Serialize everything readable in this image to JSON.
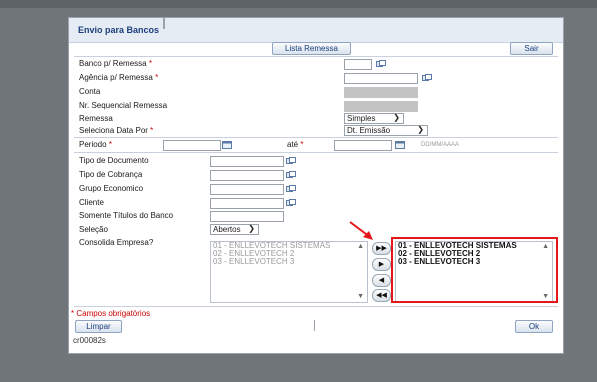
{
  "window": {
    "title": "Envio para Bancos"
  },
  "toolbar": {
    "lista_remessa": "Lista Remessa",
    "sair": "Sair"
  },
  "fields": {
    "banco_label": "Banco p/ Remessa",
    "agencia_label": "Agência p/ Remessa",
    "conta_label": "Conta",
    "nr_seq_label": "Nr. Sequencial Remessa",
    "remessa_label": "Remessa",
    "remessa_value": "Simples",
    "data_por_label": "Seleciona Data Por",
    "data_por_value": "Dt. Emissão",
    "periodo_label": "Periodo",
    "ate_label": "até",
    "date_hint": "DD/MM/AAAA",
    "tipo_doc_label": "Tipo de Documento",
    "tipo_cob_label": "Tipo de Cobrança",
    "grupo_eco_label": "Grupo Economico",
    "cliente_label": "Cliente",
    "somente_label": "Somente Títulos do Banco",
    "selecao_label": "Seleção",
    "selecao_value": "Abertos",
    "consolida_label": "Consolida Empresa?"
  },
  "required_mark": "*",
  "lists": {
    "available": [
      "01 - ENLLEVOTECH SISTEMAS",
      "02 - ENLLEVOTECH 2",
      "03 - ENLLEVOTECH 3"
    ],
    "selected": [
      "01 - ENLLEVOTECH SISTEMAS",
      "02 - ENLLEVOTECH 2",
      "03 - ENLLEVOTECH 3"
    ]
  },
  "transfer": {
    "all_right": "▶▶",
    "right": "▶",
    "left": "◀",
    "all_left": "◀◀"
  },
  "footer": {
    "required_note": "* Campos obrigatórios",
    "limpar": "Limpar",
    "ok": "Ok",
    "screen_code": "cr00082s"
  },
  "colors": {
    "annotation": "#e3161b",
    "title_text": "#1b3f7a",
    "required": "#cc0000"
  },
  "icons": {
    "lookup": "lookup-icon",
    "annotation_arrow": "red-arrow-icon"
  }
}
